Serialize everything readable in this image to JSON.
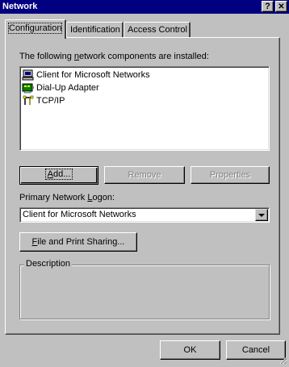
{
  "window": {
    "title": "Network",
    "help_glyph": "?",
    "close_glyph": "✕"
  },
  "tabs": [
    {
      "label": "Configuration",
      "active": true
    },
    {
      "label": "Identification",
      "active": false
    },
    {
      "label": "Access Control",
      "active": false
    }
  ],
  "config": {
    "installed_label_pre": "The following ",
    "installed_label_u": "n",
    "installed_label_post": "etwork components are installed:",
    "components": [
      {
        "label": "Client for Microsoft Networks",
        "icon": "network-client-icon"
      },
      {
        "label": "Dial-Up Adapter",
        "icon": "network-adapter-icon"
      },
      {
        "label": "TCP/IP",
        "icon": "protocol-icon"
      }
    ],
    "add_label_u": "A",
    "add_label_rest": "dd...",
    "remove_label": "Remove",
    "properties_label": "Properties",
    "logon_label_pre": "Primary Network ",
    "logon_label_u": "L",
    "logon_label_post": "ogon:",
    "logon_value": "Client for Microsoft Networks",
    "file_print_u": "F",
    "file_print_rest": "ile and Print Sharing...",
    "description_label": "Description"
  },
  "footer": {
    "ok_label": "OK",
    "cancel_label": "Cancel"
  },
  "colors": {
    "titlebar": "#000080",
    "face": "#c0c0c0"
  }
}
